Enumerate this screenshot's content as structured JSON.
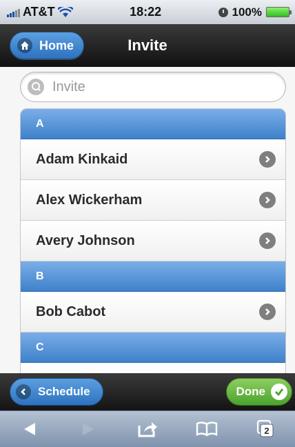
{
  "status_bar": {
    "carrier": "AT&T",
    "time": "18:22",
    "battery": "100%"
  },
  "header": {
    "title": "Invite",
    "home_label": "Home"
  },
  "search": {
    "placeholder": "Invite"
  },
  "list": {
    "groups": [
      {
        "letter": "A",
        "items": [
          "Adam Kinkaid",
          "Alex Wickerham",
          "Avery Johnson"
        ]
      },
      {
        "letter": "B",
        "items": [
          "Bob Cabot"
        ]
      },
      {
        "letter": "C",
        "items": []
      }
    ]
  },
  "footer": {
    "back_label": "Schedule",
    "done_label": "Done"
  },
  "toolbar": {
    "tabs_count": "2"
  },
  "colors": {
    "accent_blue": "#3f81cb",
    "done_green": "#4aa32c",
    "bar_dark": "#141414"
  }
}
